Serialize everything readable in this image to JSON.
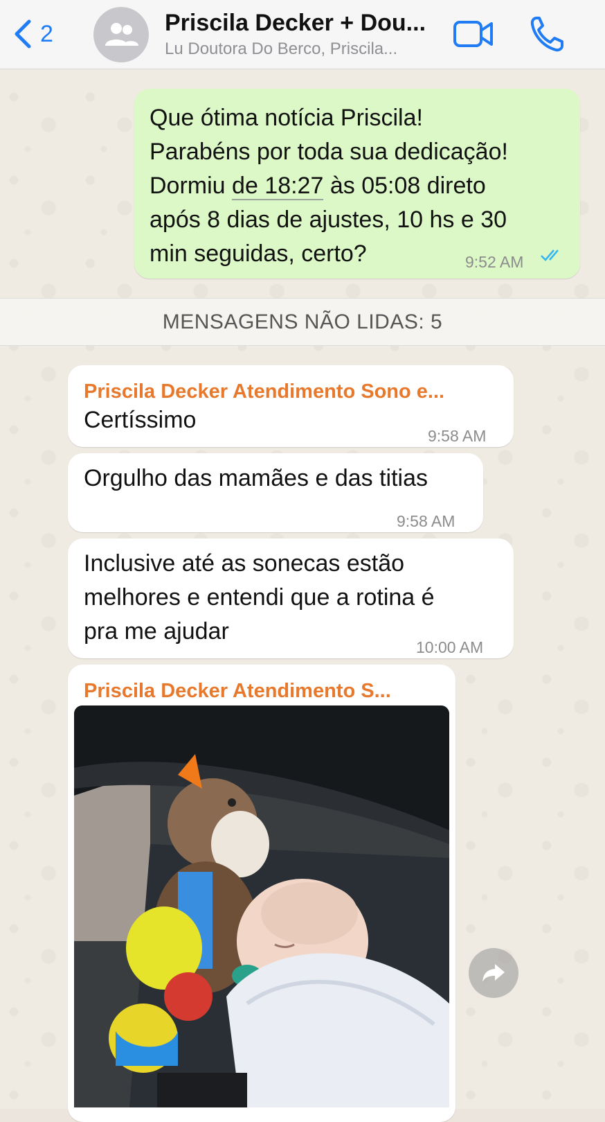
{
  "header": {
    "back_count": "2",
    "title": "Priscila Decker + Dou...",
    "subtitle": "Lu Doutora Do Berco, Priscila...",
    "accent_color": "#1f7cf5",
    "icons": [
      "chevron-left-icon",
      "group-avatar-icon",
      "video-call-icon",
      "phone-icon"
    ]
  },
  "messages": {
    "out1": {
      "line1": "Que ótima notícia Priscila!",
      "line2": "Parabéns por toda sua dedicação!",
      "line3_pre": "Dormiu ",
      "line3_link": "de 18:27",
      "line3_post": " às 05:08 direto",
      "line4": "após 8 dias de ajustes, 10 hs e 30",
      "line5": "min seguidas, certo?",
      "time": "9:52 AM",
      "status": "read"
    },
    "unread_label": "MENSAGENS NÃO LIDAS: 5",
    "in1": {
      "sender": "Priscila Decker Atendimento Sono e...",
      "text": "Certíssimo",
      "time": "9:58 AM"
    },
    "in2": {
      "text": "Orgulho das mamães e das titias",
      "time": "9:58 AM"
    },
    "in3": {
      "line1": "Inclusive até as sonecas estão",
      "line2": "melhores e entendi que a rotina é",
      "line3": "pra me ajudar",
      "time": "10:00 AM"
    },
    "in4": {
      "sender": "Priscila Decker Atendimento S..."
    }
  },
  "colors": {
    "outgoing_bubble": "#dbf8c6",
    "incoming_bubble": "#ffffff",
    "sender_name": "#e8782b",
    "read_ticks": "#34b7f1"
  }
}
